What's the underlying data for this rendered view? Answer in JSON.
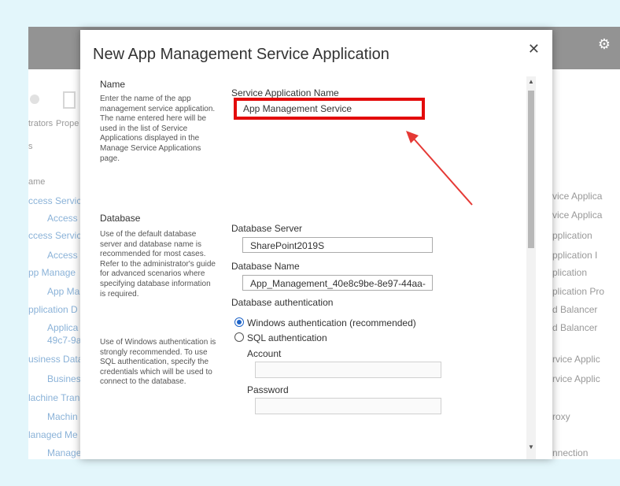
{
  "background": {
    "toolbar_labels": [
      "trators",
      "Prope"
    ],
    "small_label": "s",
    "column_header": "ame",
    "left_items": [
      "ccess Servic",
      "Access S",
      "ccess Servic",
      "Access S",
      "pp Manage",
      "App Ma",
      "pplication D",
      "Applica",
      "49c7-9a",
      "usiness Data",
      "Busines",
      "lachine Tran",
      "Machin",
      "lanaged Me",
      "Manage"
    ],
    "right_items": [
      "vice Applica",
      "vice Applica",
      "pplication",
      "pplication I",
      "plication",
      "plication Pro",
      "d Balancer",
      "d Balancer",
      "rvice Applic",
      "rvice Applic",
      "roxy",
      "nnection"
    ]
  },
  "dialog": {
    "title": "New App Management Service Application",
    "close_icon": "close-icon",
    "name_section": {
      "heading": "Name",
      "description": "Enter the name of the app management service application. The name entered here will be used in the list of Service Applications displayed in the Manage Service Applications page."
    },
    "service_app_name": {
      "label": "Service Application Name",
      "value": "App Management Service"
    },
    "database_section": {
      "heading": "Database",
      "description1": "Use of the default database server and database name is recommended for most cases. Refer to the administrator's guide for advanced scenarios where specifying database information is required.",
      "description2": "Use of Windows authentication is strongly recommended. To use SQL authentication, specify the credentials which will be used to connect to the database."
    },
    "database_server": {
      "label": "Database Server",
      "value": "SharePoint2019S"
    },
    "database_name": {
      "label": "Database Name",
      "value": "App_Management_40e8c9be-8e97-44aa-"
    },
    "db_auth": {
      "label": "Database authentication",
      "options": [
        "Windows authentication (recommended)",
        "SQL authentication"
      ],
      "selected": "Windows authentication (recommended)"
    },
    "account": {
      "label": "Account",
      "value": ""
    },
    "password": {
      "label": "Password",
      "value": ""
    }
  },
  "colors": {
    "highlight": "#e30b0b",
    "arrow": "#e53935",
    "suitebar": "#3b3b3b",
    "page_bg": "#e3f6fb"
  }
}
